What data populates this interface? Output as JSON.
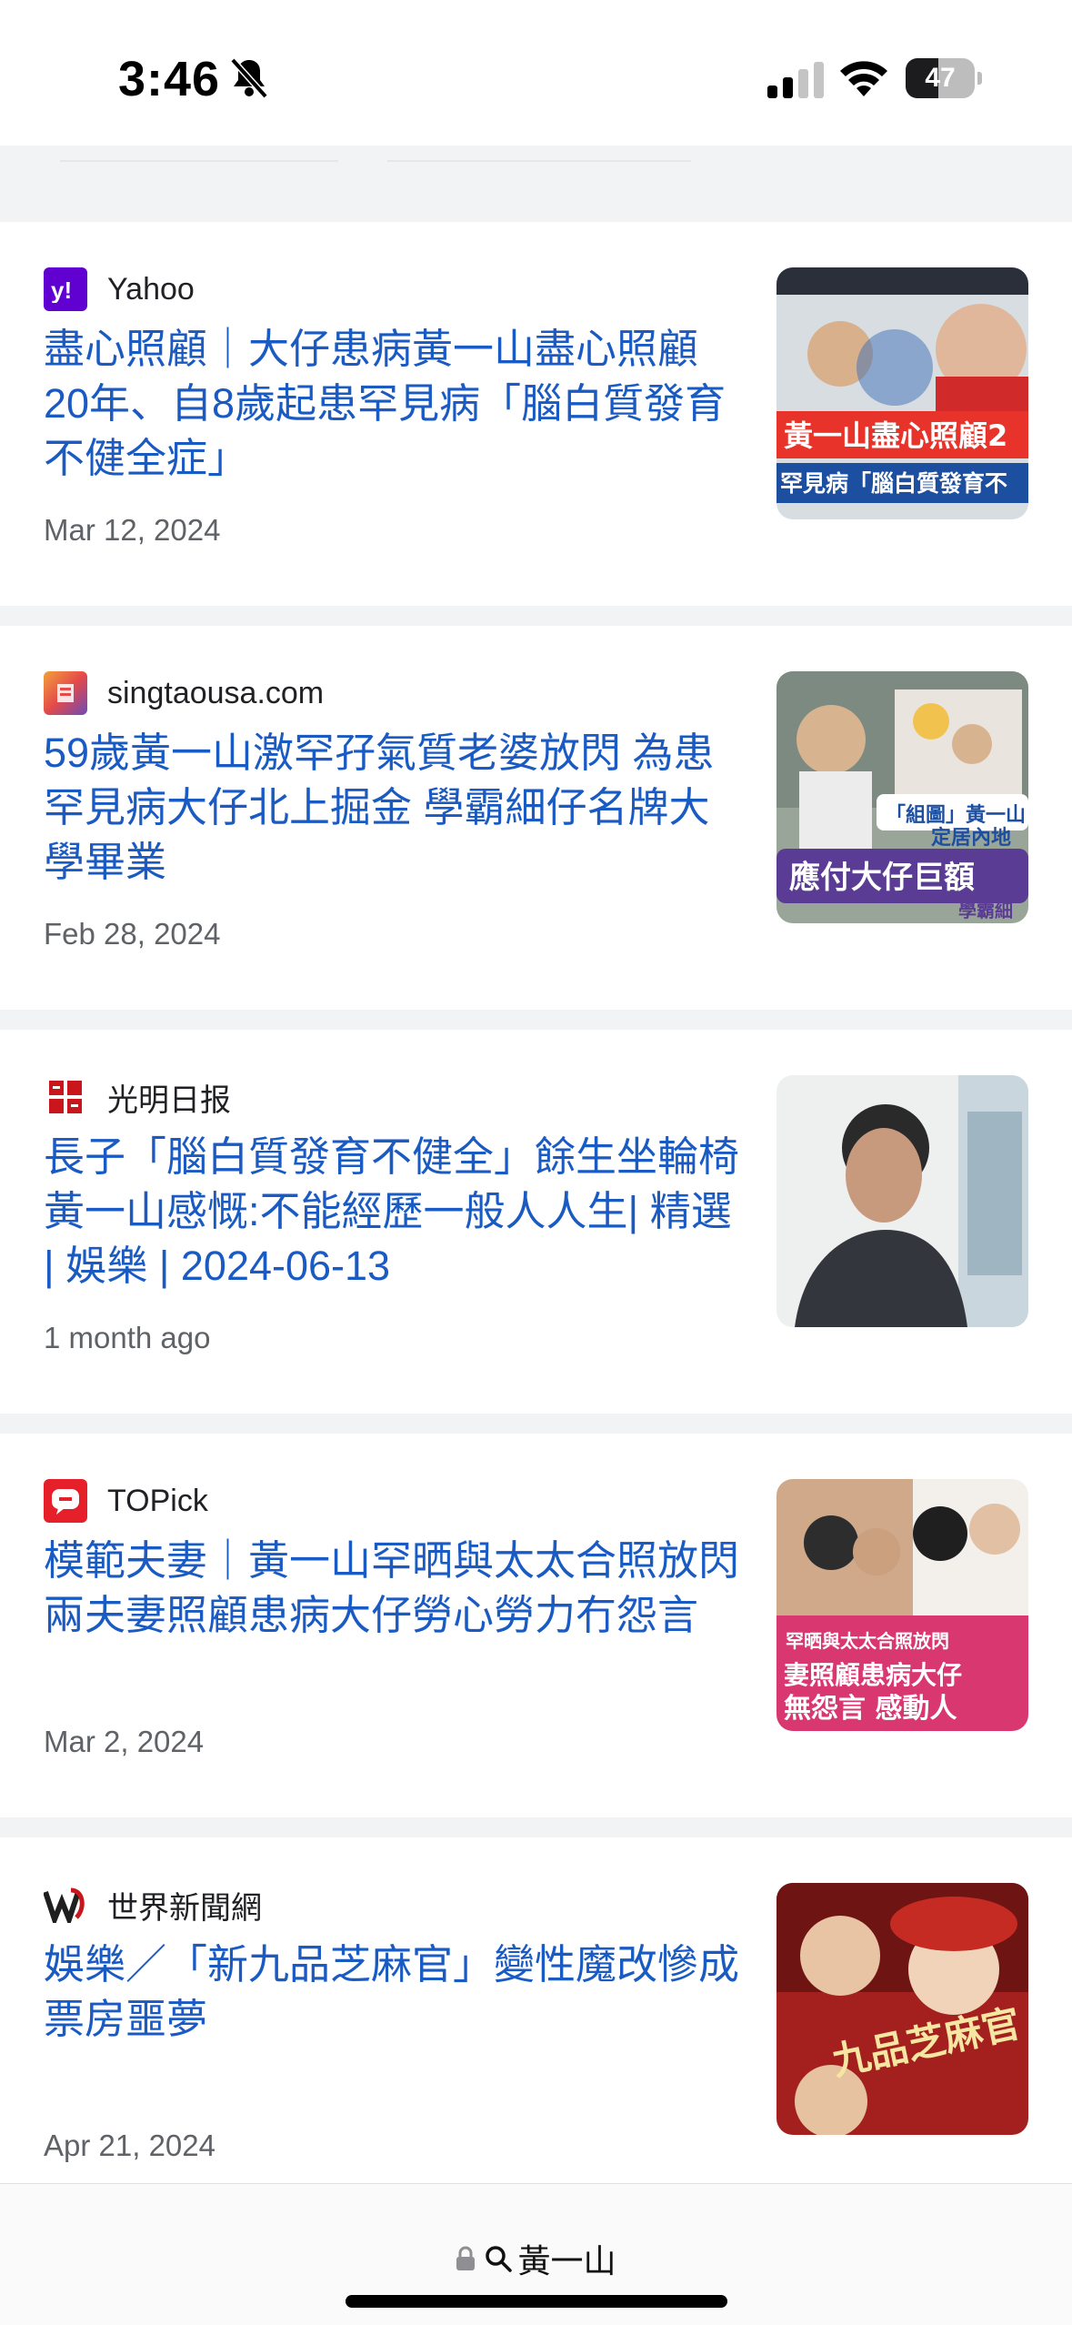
{
  "status_bar": {
    "time": "3:46",
    "battery": "47",
    "battery_level": 0.47
  },
  "feed": [
    {
      "source": "Yahoo",
      "favicon": "yahoo-icon",
      "headline": "盡心照顧｜大仔患病黃一山盡心照顧20年、自8歲起患罕見病「腦白質發育不健全症」",
      "date": "Mar 12, 2024",
      "thumb_text": [
        "黃一山盡心照顧2",
        "罕見病「腦白質發育不"
      ]
    },
    {
      "source": "singtaousa.com",
      "favicon": "singtao-icon",
      "headline": "59歲黃一山激罕孖氣質老婆放閃 為患罕見病大仔北上掘金 學霸細仔名牌大學畢業",
      "date": "Feb 28, 2024",
      "thumb_text": [
        "「組圖」黃一山",
        "定居內地",
        "應付大仔巨額",
        "學霸細"
      ]
    },
    {
      "source": "光明日报",
      "favicon": "guangming-icon",
      "headline": "長子「腦白質發育不健全」餘生坐輪椅黃一山感慨:不能經歷一般人人生| 精選 | 娛樂 | 2024-06-13",
      "date": "1 month ago",
      "thumb_text": []
    },
    {
      "source": "TOPick",
      "favicon": "topick-icon",
      "headline": "模範夫妻｜黃一山罕晒與太太合照放閃 兩夫妻照顧患病大仔勞心勞力冇怨言",
      "date": "Mar 2, 2024",
      "thumb_text": [
        "罕晒與太太合照放閃",
        "妻照顧患病大仔",
        "無怨言 感動人"
      ]
    },
    {
      "source": "世界新聞網",
      "favicon": "worldjournal-icon",
      "headline": "娛樂／「新九品芝麻官」變性魔改慘成票房噩夢",
      "date": "Apr 21, 2024",
      "thumb_text": [
        "九品芝麻官"
      ]
    }
  ],
  "bottom_bar": {
    "query": "黃一山"
  },
  "colors": {
    "link": "#1a5ac3",
    "meta": "#5f6368",
    "background": "#f1f3f4"
  }
}
